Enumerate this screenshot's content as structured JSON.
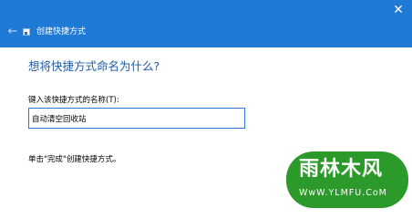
{
  "window": {
    "title": "创建快捷方式",
    "close_glyph": "✕",
    "back_glyph": "←"
  },
  "page": {
    "heading": "想将快捷方式命名为什么?",
    "name_label": "键入该快捷方式的名称(T):",
    "name_value": "自动清空回收站",
    "hint": "单击\"完成\"创建快捷方式。"
  },
  "watermark": {
    "name": "雨林木风",
    "url": "WwW.YLMFU.CoM"
  },
  "colors": {
    "title_bar": "#1f7ad6",
    "heading": "#1c5ca8",
    "input_border": "#2d7ad6",
    "watermark_bg": "#2c9a2a"
  },
  "icons": {
    "back": "arrow-left-icon",
    "close": "close-icon",
    "wizard": "shortcut-icon"
  }
}
